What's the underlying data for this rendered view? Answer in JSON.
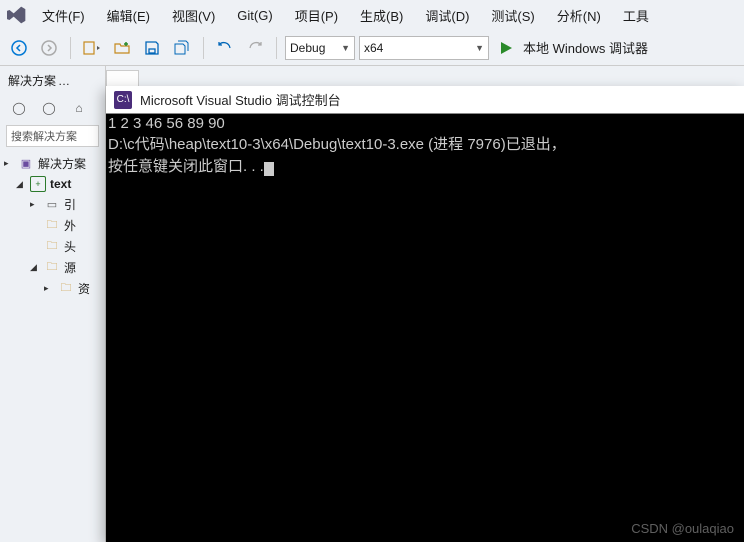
{
  "menu": {
    "file": "文件(F)",
    "edit": "编辑(E)",
    "view": "视图(V)",
    "git": "Git(G)",
    "project": "项目(P)",
    "build": "生成(B)",
    "debug": "调试(D)",
    "test": "测试(S)",
    "analyze": "分析(N)",
    "tools": "工具"
  },
  "toolbar": {
    "config": "Debug",
    "platform": "x64",
    "localDebugger": "本地 Windows 调试器"
  },
  "side": {
    "title": "解决方案",
    "searchPlaceholder": "搜索解决方案",
    "solutionLabel": "解决方案",
    "projectLabel": "text",
    "ref": "引",
    "ext": "外",
    "hdr": "头",
    "src": "源",
    "cpp": "资"
  },
  "console": {
    "title": "Microsoft Visual Studio 调试控制台",
    "iconText": "C:\\",
    "line1": "1 2 3 46 56 89 90",
    "line2": "D:\\c代码\\heap\\text10-3\\x64\\Debug\\text10-3.exe (进程 7976)已退出，",
    "line3": "按任意键关闭此窗口. . ."
  },
  "watermark": "CSDN @oulaqiao"
}
